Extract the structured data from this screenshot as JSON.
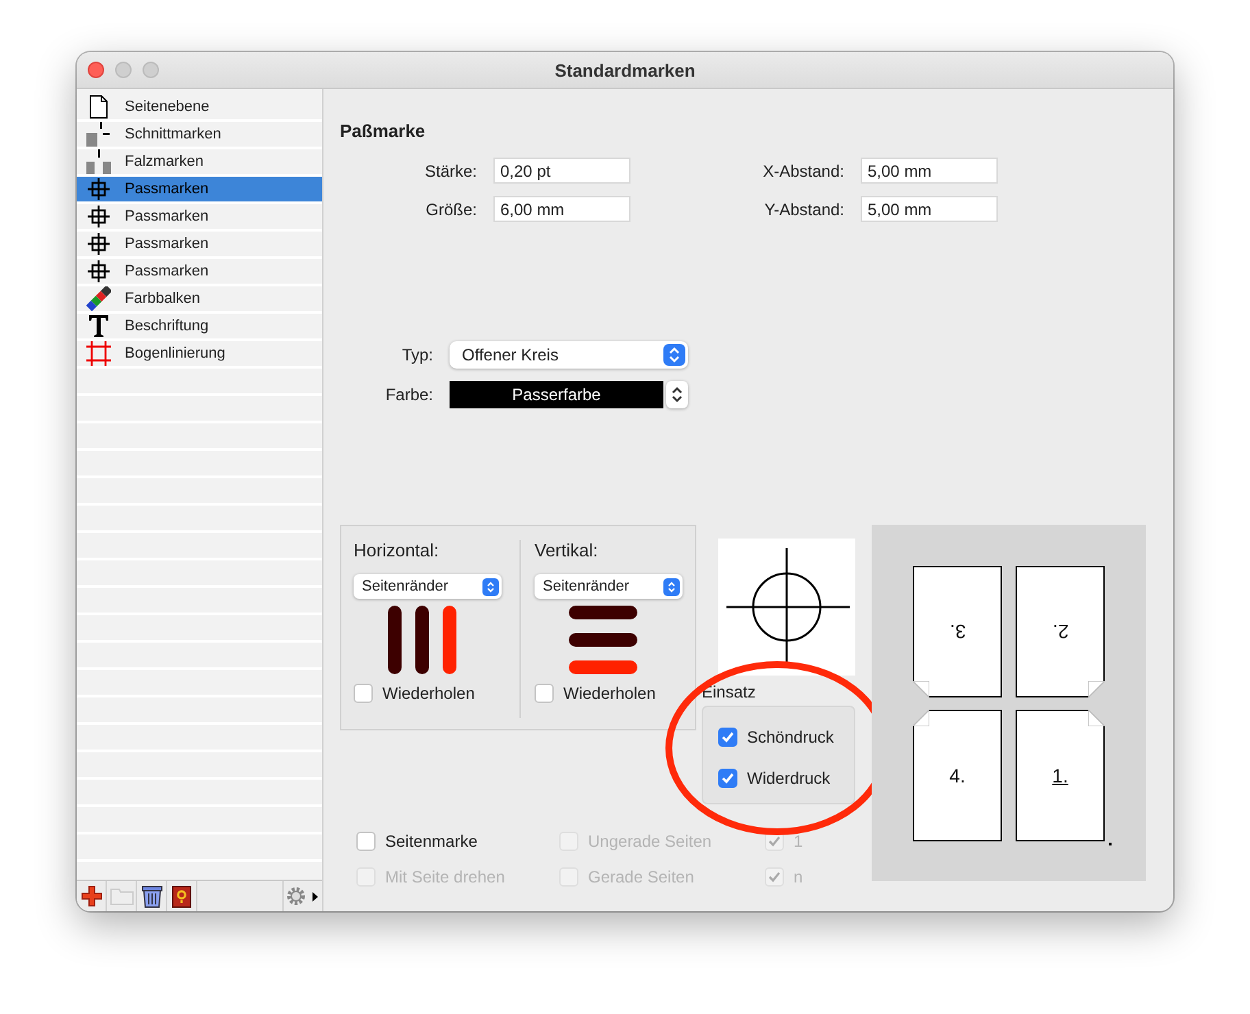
{
  "window": {
    "title": "Standardmarken"
  },
  "sidebar": {
    "items": [
      {
        "label": "Seitenebene",
        "kind": "page",
        "selected": false
      },
      {
        "label": "Schnittmarken",
        "kind": "cut",
        "selected": false
      },
      {
        "label": "Falzmarken",
        "kind": "fold",
        "selected": false
      },
      {
        "label": "Passmarken",
        "kind": "register",
        "selected": true
      },
      {
        "label": "Passmarken",
        "kind": "register",
        "selected": false
      },
      {
        "label": "Passmarken",
        "kind": "register",
        "selected": false
      },
      {
        "label": "Passmarken",
        "kind": "register",
        "selected": false
      },
      {
        "label": "Farbbalken",
        "kind": "colorbar",
        "selected": false
      },
      {
        "label": "Beschriftung",
        "kind": "text",
        "selected": false
      },
      {
        "label": "Bogenlinierung",
        "kind": "grid",
        "selected": false
      }
    ]
  },
  "section_title": "Paßmarke",
  "fields": [
    {
      "label": "Stärke:",
      "value": "0,20 pt"
    },
    {
      "label": "X-Abstand:",
      "value": "5,00 mm"
    },
    {
      "label": "Größe:",
      "value": "6,00 mm"
    },
    {
      "label": "Y-Abstand:",
      "value": "5,00 mm"
    }
  ],
  "typ": {
    "label": "Typ:",
    "value": "Offener Kreis"
  },
  "farbe": {
    "label": "Farbe:",
    "value": "Passerfarbe"
  },
  "directions": [
    {
      "label": "Horizontal:",
      "kind": "horizontal",
      "value": "Seitenränder",
      "repeat": {
        "label": "Wiederholen",
        "checked": false
      }
    },
    {
      "label": "Vertikal:",
      "kind": "vertical",
      "value": "Seitenränder",
      "repeat": {
        "label": "Wiederholen",
        "checked": false
      }
    }
  ],
  "einsatz": {
    "label": "Einsatz",
    "options": [
      {
        "label": "Schöndruck",
        "checked": true
      },
      {
        "label": "Widerdruck",
        "checked": true
      }
    ]
  },
  "options": [
    {
      "label": "Seitenmarke",
      "checked": false,
      "disabled": false
    },
    {
      "label": "Ungerade Seiten",
      "checked": false,
      "disabled": true
    },
    {
      "label": "1",
      "checked": true,
      "disabled": true
    },
    {
      "label": "Mit Seite drehen",
      "checked": false,
      "disabled": true
    },
    {
      "label": "Gerade Seiten",
      "checked": false,
      "disabled": true
    },
    {
      "label": "n",
      "checked": true,
      "disabled": true
    }
  ],
  "pages": [
    {
      "label": "3.",
      "rotated": true,
      "kind": "bottom-left",
      "underlined": false
    },
    {
      "label": "2.",
      "rotated": true,
      "kind": "bottom-right",
      "underlined": false
    },
    {
      "label": "4.",
      "rotated": false,
      "kind": "top-left",
      "underlined": false
    },
    {
      "label": "1.",
      "rotated": false,
      "kind": "top-right",
      "underlined": true
    }
  ],
  "annotation": {
    "kind": "circle"
  }
}
